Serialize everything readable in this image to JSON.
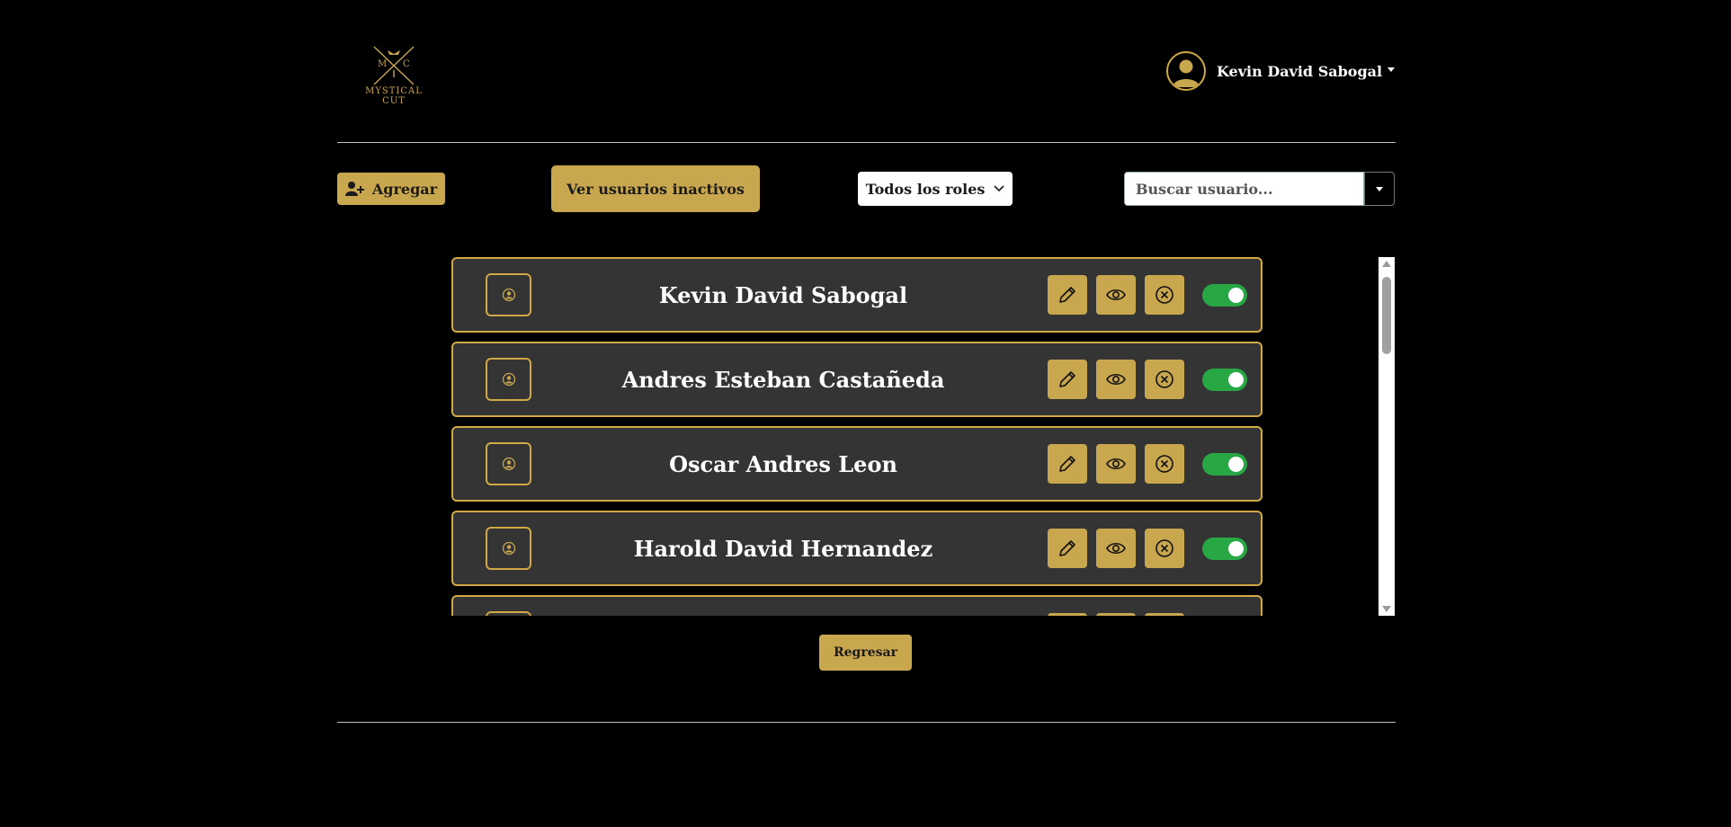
{
  "header": {
    "logo_initials_left": "M",
    "logo_initials_right": "C",
    "logo_line1": "MYSTICAL",
    "logo_line2": "CUT",
    "user_name": "Kevin David Sabogal"
  },
  "toolbar": {
    "add_label": "Agregar",
    "inactive_label": "Ver usuarios inactivos",
    "role_label": "Todos los roles",
    "search_placeholder": "Buscar usuario..."
  },
  "users": [
    {
      "name": "Kevin David Sabogal",
      "active": true
    },
    {
      "name": "Andres Esteban Castañeda",
      "active": true
    },
    {
      "name": "Oscar Andres Leon",
      "active": true
    },
    {
      "name": "Harold David Hernandez",
      "active": true
    },
    {
      "name": "",
      "active": true
    }
  ],
  "footer": {
    "back_label": "Regresar"
  },
  "colors": {
    "accent": "#c9a74e",
    "card_bg": "#343434",
    "toggle_on": "#28a745",
    "background": "#000000"
  },
  "icons": {
    "add": "user-plus-icon",
    "edit": "pencil-icon",
    "view": "eye-icon",
    "deactivate": "circle-x-icon",
    "avatar": "user-circle-icon"
  }
}
